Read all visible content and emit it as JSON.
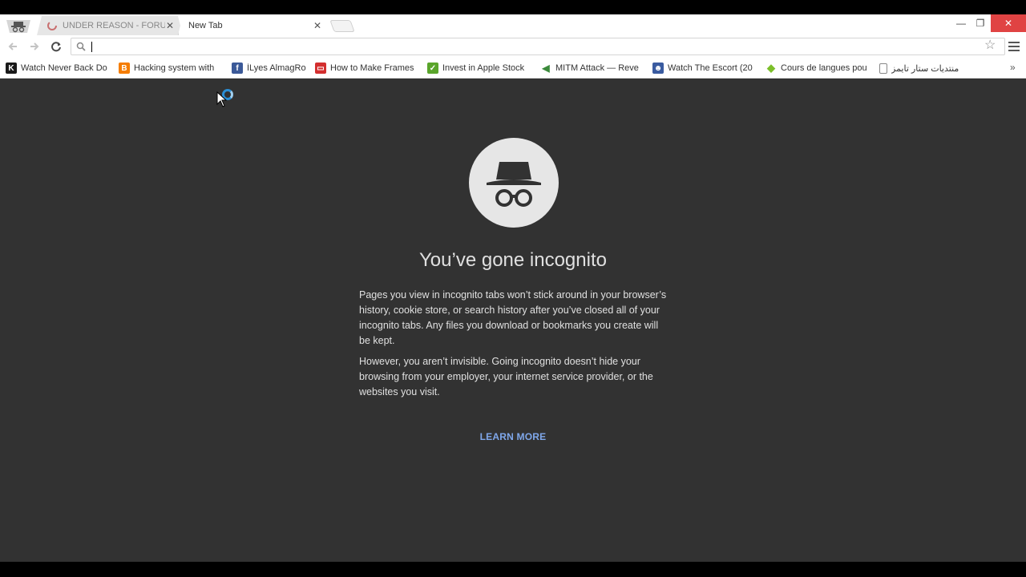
{
  "tabs": [
    {
      "title": "UNDER REASON - FORUM",
      "active": false
    },
    {
      "title": "New Tab",
      "active": true
    }
  ],
  "omnibox": {
    "value": "",
    "placeholder": ""
  },
  "bookmarks": [
    {
      "label": "Watch Never Back Do",
      "icon": "k-icon",
      "color": "#1a1a1a",
      "glyph": "K"
    },
    {
      "label": "Hacking system with",
      "icon": "blogger-icon",
      "color": "#f57d00",
      "glyph": "B"
    },
    {
      "label": "İLyes AlmagRo",
      "icon": "facebook-icon",
      "color": "#3b5998",
      "glyph": "f"
    },
    {
      "label": "How to Make Frames",
      "icon": "red-site-icon",
      "color": "#d32f2f",
      "glyph": "▭"
    },
    {
      "label": "Invest in Apple Stock",
      "icon": "green-site-icon",
      "color": "#5aa52b",
      "glyph": "✓"
    },
    {
      "label": "MITM Attack — Reve",
      "icon": "arrow-icon",
      "color": "#3b8a3b",
      "glyph": "◀"
    },
    {
      "label": "Watch The Escort (20",
      "icon": "people-icon",
      "color": "#3a5ba0",
      "glyph": "☻"
    },
    {
      "label": "Cours de langues pou",
      "icon": "diamond-icon",
      "color": "#7cbf2a",
      "glyph": "◆"
    },
    {
      "label": "منتديات ستار تايمز",
      "icon": "page-icon",
      "color": "#ffffff",
      "glyph": ""
    }
  ],
  "content": {
    "heading": "You’ve gone incognito",
    "paragraph1": "Pages you view in incognito tabs won’t stick around in your browser’s history, cookie store, or search history after you’ve closed all of your incognito tabs. Any files you download or bookmarks you create will be kept.",
    "paragraph2": "However, you aren’t invisible. Going incognito doesn’t hide your browsing from your employer, your internet service provider, or the websites you visit.",
    "learn_more": "LEARN MORE"
  },
  "colors": {
    "content_bg": "#323232",
    "link": "#7fa7ea",
    "close_button": "#e04343"
  }
}
